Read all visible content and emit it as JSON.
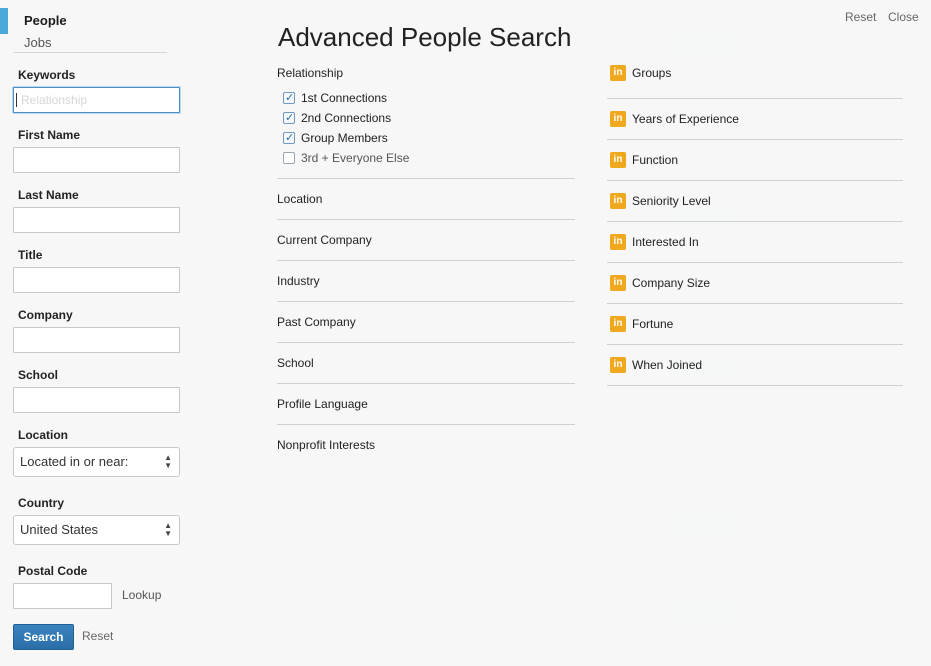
{
  "nav": {
    "people": "People",
    "jobs": "Jobs"
  },
  "form": {
    "keywords_label": "Keywords",
    "keywords_value": "",
    "keywords_ghost": "Relationship",
    "first_name_label": "First Name",
    "first_name_value": "",
    "last_name_label": "Last Name",
    "last_name_value": "",
    "title_label": "Title",
    "title_value": "",
    "company_label": "Company",
    "company_value": "",
    "school_label": "School",
    "school_value": "",
    "location_label": "Location",
    "location_select": "Located in or near:",
    "country_label": "Country",
    "country_select": "United States",
    "postal_label": "Postal Code",
    "postal_value": "",
    "lookup": "Lookup",
    "search_button": "Search",
    "reset": "Reset"
  },
  "header": {
    "title": "Advanced People Search",
    "reset": "Reset",
    "close": "Close"
  },
  "relationship": {
    "label": "Relationship",
    "options": [
      {
        "label": "1st Connections",
        "checked": true
      },
      {
        "label": "2nd Connections",
        "checked": true
      },
      {
        "label": "Group Members",
        "checked": true
      },
      {
        "label": "3rd + Everyone Else",
        "checked": false
      }
    ]
  },
  "facets": [
    "Location",
    "Current Company",
    "Industry",
    "Past Company",
    "School",
    "Profile Language",
    "Nonprofit Interests"
  ],
  "premium_badge": "in",
  "premium_facets": [
    "Groups",
    "Years of Experience",
    "Function",
    "Seniority Level",
    "Interested In",
    "Company Size",
    "Fortune",
    "When Joined"
  ],
  "colors": {
    "accent": "#4aa8d8",
    "search_button": "#2f76b2",
    "premium_badge": "#f0a81e"
  }
}
